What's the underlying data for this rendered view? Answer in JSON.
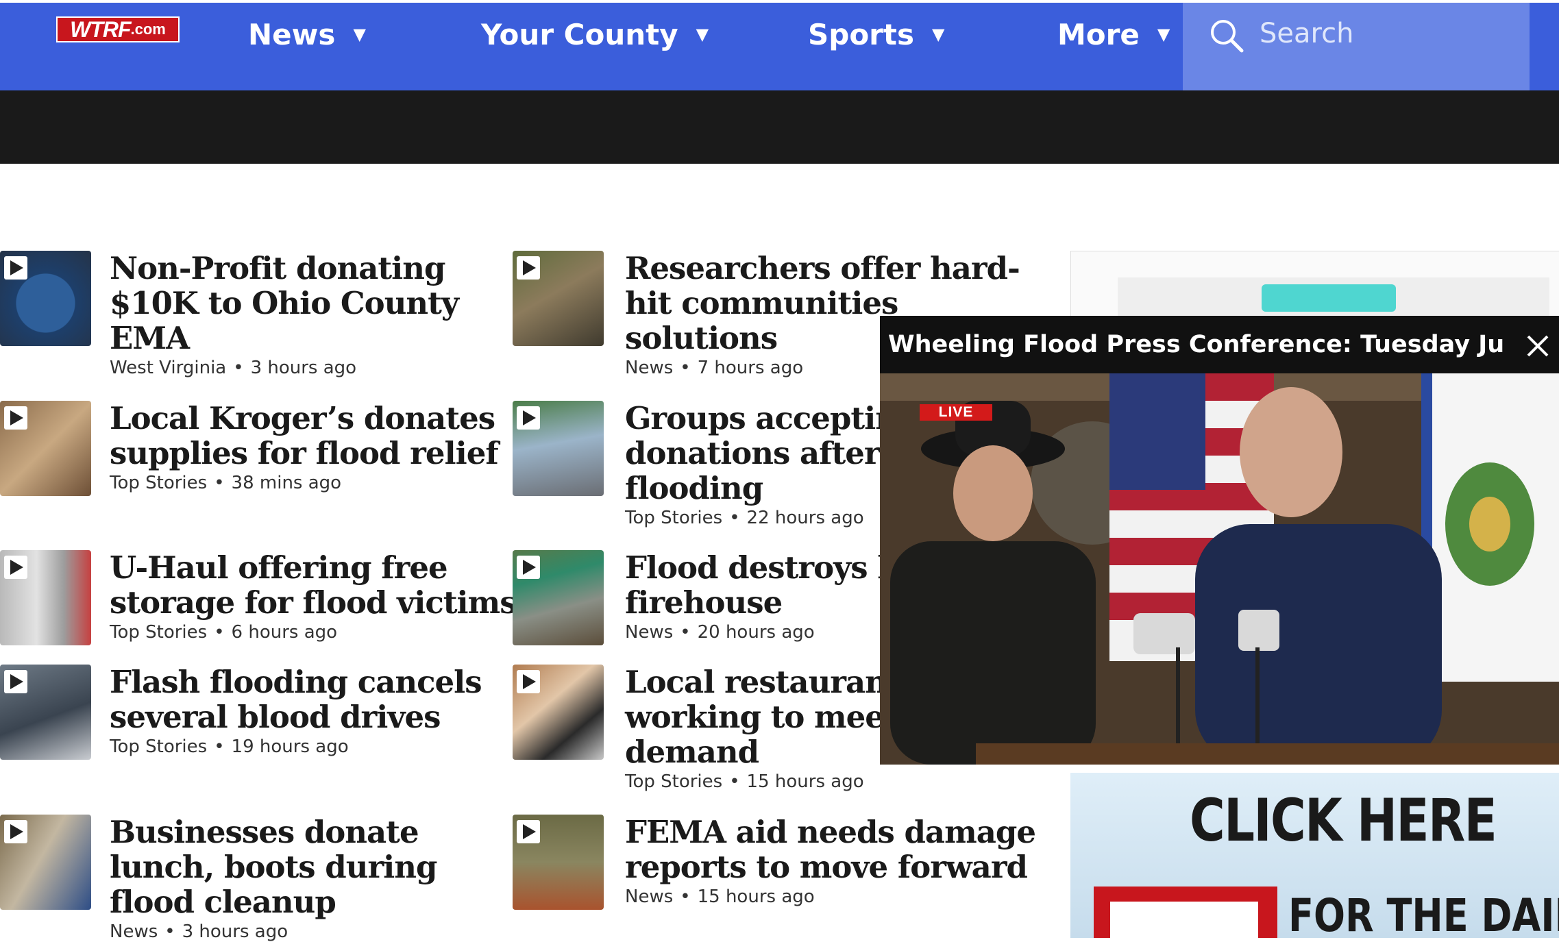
{
  "site": {
    "logo_main": "WTRF",
    "logo_suffix": ".com"
  },
  "nav": {
    "items": [
      {
        "label": "News"
      },
      {
        "label": "Your County"
      },
      {
        "label": "Sports"
      },
      {
        "label": "More"
      }
    ],
    "search_placeholder": "Search"
  },
  "articles": [
    {
      "headline": [
        "Non-Profit donating",
        "$10K to Ohio County",
        "EMA"
      ],
      "category": "West Virginia",
      "time": "3 hours ago"
    },
    {
      "headline": [
        "Local Kroger’s donates",
        "supplies for flood relief"
      ],
      "category": "Top Stories",
      "time": "38 mins ago"
    },
    {
      "headline": [
        "U-Haul offering free",
        "storage for flood victims"
      ],
      "category": "Top Stories",
      "time": "6 hours ago"
    },
    {
      "headline": [
        "Flash flooding cancels",
        "several blood drives"
      ],
      "category": "Top Stories",
      "time": "19 hours ago"
    },
    {
      "headline": [
        "Businesses donate",
        "lunch, boots during",
        "flood cleanup"
      ],
      "category": "News",
      "time": "3 hours ago"
    },
    {
      "headline": [
        "Researchers offer hard-",
        "hit communities",
        "solutions"
      ],
      "category": "News",
      "time": "7 hours ago"
    },
    {
      "headline": [
        "Groups accepting",
        "donations after O",
        "flooding"
      ],
      "category": "Top Stories",
      "time": "22 hours ago"
    },
    {
      "headline": [
        "Flood destroys lo",
        "firehouse"
      ],
      "category": "News",
      "time": "20 hours ago"
    },
    {
      "headline": [
        "Local restaurant",
        "working to meet",
        "demand"
      ],
      "category": "Top Stories",
      "time": "15 hours ago"
    },
    {
      "headline": [
        "FEMA aid needs damage",
        "reports to move forward"
      ],
      "category": "News",
      "time": "15 hours ago"
    }
  ],
  "video_player": {
    "title": "Wheeling Flood Press Conference: Tuesday June...",
    "badge": "LIVE"
  },
  "ads": {
    "cta": "CLICK HERE",
    "tagline": "FOR THE DAIL"
  },
  "colors": {
    "nav_bg": "#3b5edb",
    "search_bg": "#6a86e6",
    "band": "#1a1a1a",
    "brand_red": "#c8161d"
  }
}
